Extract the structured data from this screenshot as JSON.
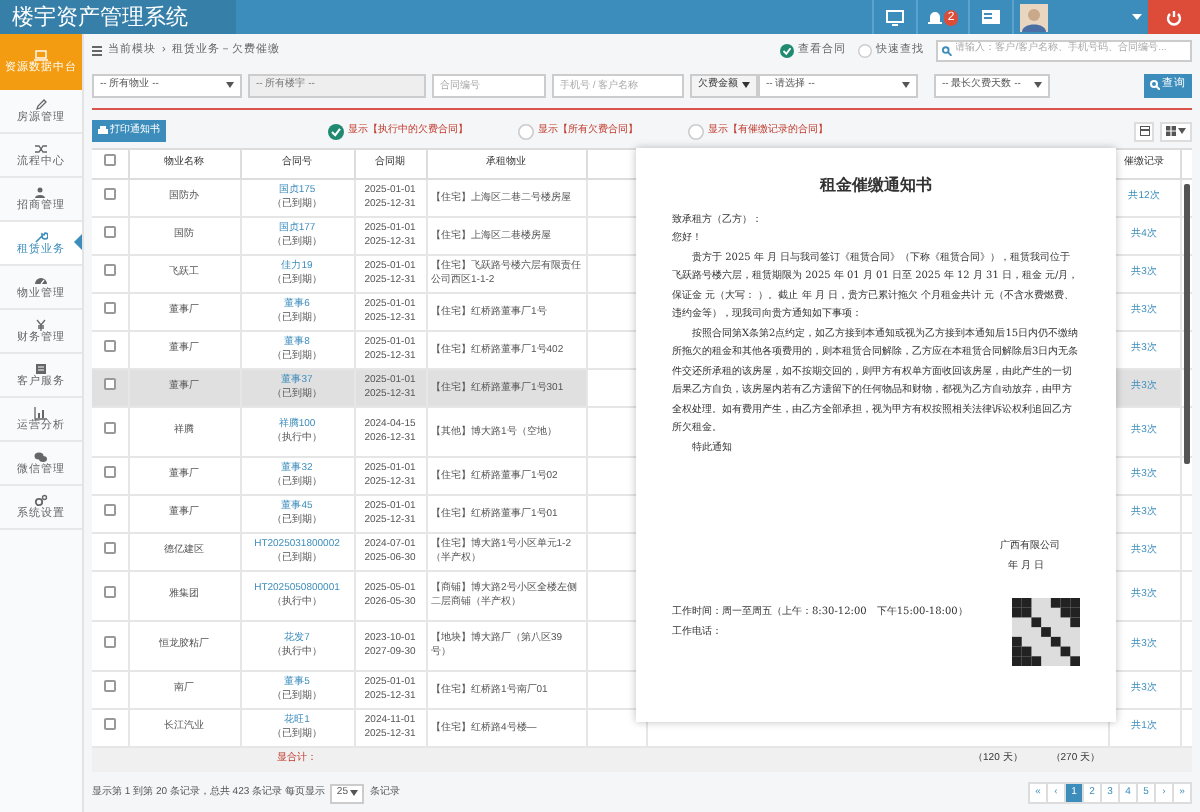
{
  "app": {
    "title": "楼宇资产管理系统",
    "notifications": "2"
  },
  "sidebar": {
    "items": [
      {
        "label": "资源数据中台",
        "selected": false,
        "kind": "home"
      },
      {
        "label": "房源管理",
        "selected": false,
        "kind": "item"
      },
      {
        "label": "流程中心",
        "selected": false,
        "kind": "item"
      },
      {
        "label": "招商管理",
        "selected": false,
        "kind": "item"
      },
      {
        "label": "租赁业务",
        "selected": true,
        "kind": "item"
      },
      {
        "label": "物业管理",
        "selected": false,
        "kind": "item"
      },
      {
        "label": "财务管理",
        "selected": false,
        "kind": "item"
      },
      {
        "label": "客户服务",
        "selected": false,
        "kind": "item"
      },
      {
        "label": "运营分析",
        "selected": false,
        "kind": "item"
      },
      {
        "label": "微信管理",
        "selected": false,
        "kind": "item"
      },
      {
        "label": "系统设置",
        "selected": false,
        "kind": "item"
      }
    ]
  },
  "breadcrumb": {
    "items": [
      "当前模块",
      "租赁业务－欠费催缴"
    ],
    "separator": "›"
  },
  "view_options": [
    {
      "label": "查看合同",
      "selected": true
    },
    {
      "label": "快速查找",
      "selected": false
    }
  ],
  "quick_search": {
    "placeholder": "请输入：客户/客户名称、手机号码、合同编号..."
  },
  "filters": {
    "property": "-- 所有物业 --",
    "building": "-- 所有楼宇 --",
    "contract_no": {
      "placeholder": "合同编号"
    },
    "customer": {
      "placeholder": "手机号 / 客户名称"
    },
    "amount_button": "欠费金额",
    "amount": "-- 请选择 --",
    "days": "-- 最长欠费天数 --",
    "search_button": "查询"
  },
  "print_button": "打印通知书",
  "show_options": [
    {
      "label": "显示【执行中的欠费合同】",
      "selected": true
    },
    {
      "label": "显示【所有欠费合同】",
      "selected": false
    },
    {
      "label": "显示【有催缴记录的合同】",
      "selected": false
    }
  ],
  "table": {
    "select_all": false,
    "columns": [
      "物业名称",
      "合同号",
      "合同期",
      "承租物业",
      "催缴记录"
    ],
    "rows": [
      {
        "name": "国防办",
        "checked": false,
        "contract": "国贞175",
        "status": "（已到期）",
        "start": "2025-01-01",
        "end": "2025-12-31",
        "property": "【住宅】上海区二巷二号楼房屋",
        "record": "共12次",
        "highlighted": false,
        "tall": false
      },
      {
        "name": "国防",
        "checked": false,
        "contract": "国贞177",
        "status": "（已到期）",
        "start": "2025-01-01",
        "end": "2025-12-31",
        "property": "【住宅】上海区二巷楼房屋",
        "record": "共4次",
        "highlighted": false,
        "tall": false
      },
      {
        "name": "飞跃工",
        "checked": false,
        "contract": "佳力19",
        "status": "（已到期）",
        "start": "2025-01-01",
        "end": "2025-12-31",
        "property": "【住宅】飞跃路号楼六层有限责任公司西区1-1-2",
        "record": "共3次",
        "highlighted": false,
        "tall": false
      },
      {
        "name": "董事厂",
        "checked": false,
        "contract": "董事6",
        "status": "（已到期）",
        "start": "2025-01-01",
        "end": "2025-12-31",
        "property": "【住宅】红桥路董事厂1号",
        "record": "共3次",
        "highlighted": false,
        "tall": false
      },
      {
        "name": "董事厂",
        "checked": false,
        "contract": "董事8",
        "status": "（已到期）",
        "start": "2025-01-01",
        "end": "2025-12-31",
        "property": "【住宅】红桥路董事厂1号402",
        "record": "共3次",
        "highlighted": false,
        "tall": false
      },
      {
        "name": "董事厂",
        "checked": false,
        "contract": "董事37",
        "status": "（已到期）",
        "start": "2025-01-01",
        "end": "2025-12-31",
        "property": "【住宅】红桥路董事厂1号301",
        "record": "共3次",
        "highlighted": true,
        "tall": false
      },
      {
        "name": "祥腾",
        "checked": false,
        "contract": "祥腾100",
        "status": "（执行中）",
        "start": "2024-04-15",
        "end": "2026-12-31",
        "property": "【其他】博大路1号（空地）",
        "record": "共3次",
        "highlighted": false,
        "tall": true
      },
      {
        "name": "董事厂",
        "checked": false,
        "contract": "董事32",
        "status": "（已到期）",
        "start": "2025-01-01",
        "end": "2025-12-31",
        "property": "【住宅】红桥路董事厂1号02",
        "record": "共3次",
        "highlighted": false,
        "tall": false
      },
      {
        "name": "董事厂",
        "checked": false,
        "contract": "董事45",
        "status": "（已到期）",
        "start": "2025-01-01",
        "end": "2025-12-31",
        "property": "【住宅】红桥路董事厂1号01",
        "record": "共3次",
        "highlighted": false,
        "tall": false
      },
      {
        "name": "德亿建区",
        "checked": false,
        "contract": "HT2025031800002",
        "status": "（已到期）",
        "start": "2024-07-01",
        "end": "2025-06-30",
        "property": "【住宅】博大路1号小区单元1-2（半产权）",
        "record": "共3次",
        "highlighted": false,
        "tall": false
      },
      {
        "name": "雅集团",
        "checked": false,
        "contract": "HT2025050800001",
        "status": "（执行中）",
        "start": "2025-05-01",
        "end": "2026-05-30",
        "property": "【商铺】博大路2号小区全楼左侧二层商铺（半产权）",
        "record": "共3次",
        "highlighted": false,
        "tall": true
      },
      {
        "name": "恒龙胶粘厂",
        "checked": false,
        "contract": "花发7",
        "status": "（执行中）",
        "start": "2023-10-01",
        "end": "2027-09-30",
        "property": "【地块】博大路厂（第八区39号）",
        "record": "共3次",
        "highlighted": false,
        "tall": true
      },
      {
        "name": "南厂",
        "checked": false,
        "contract": "董事5",
        "status": "（已到期）",
        "start": "2025-01-01",
        "end": "2025-12-31",
        "property": "【住宅】红桥路1号南厂01",
        "record": "共3次",
        "highlighted": false,
        "tall": false
      },
      {
        "name": "长江汽业",
        "checked": false,
        "contract": "花旺1",
        "status": "（已到期）",
        "start": "2024-11-01",
        "end": "2025-12-31",
        "property": "【住宅】红桥路4号楼—",
        "record": "共1次",
        "highlighted": false,
        "tall": false
      }
    ],
    "total_label": "显合计：",
    "total_days": [
      "（120 天）",
      "（270 天）"
    ]
  },
  "notice": {
    "title": "租金催缴通知书",
    "greeting": "致承租方（乙方）：",
    "salutation": "您好！",
    "paragraphs": [
      "贵方于 2025 年 月 日与我司签订《租赁合同》（下称《租赁合同》），租赁我司位于飞跃路号楼六层，租赁期限为 2025 年 01 月 01 日至 2025 年 12 月 31 日，租金 元/月，保证金 元（大写： ）。截止 年 月 日，贵方已累计拖欠 个月租金共计 元（不含水费燃费、违约金等），现我司向贵方通知如下事项：",
      "按照合同第X条第2点约定，如乙方接到本通知或视为乙方接到本通知后15日内仍不缴纳所拖欠的租金和其他各项费用的，则本租赁合同解除，乙方应在本租赁合同解除后3日内无条件交还所承租的该房屋，如不按期交回的，则甲方有权单方面收回该房屋，由此产生的一切后果乙方自负，该房屋内若有乙方遗留下的任何物品和财物，都视为乙方自动放弃，由甲方全权处理。如有费用产生，由乙方全部承担，视为甲方有权按照相关法律诉讼权利追回乙方所欠租金。"
    ],
    "closing": "特此通知",
    "company": "广西有限公司",
    "date": "年 月 日",
    "hours": "工作时间：周一至周五（上午：8:30-12:00　下午15:00-18:00）",
    "phone": "工作电话："
  },
  "footer": {
    "summary": "显示第 1 到第 20 条记录，总共 423 条记录 每页显示",
    "page_size": "25",
    "suffix": "条记录"
  },
  "pagination": [
    {
      "label": "«",
      "selected": false
    },
    {
      "label": "‹",
      "selected": false
    },
    {
      "label": "1",
      "selected": true
    },
    {
      "label": "2",
      "selected": false
    },
    {
      "label": "3",
      "selected": false
    },
    {
      "label": "4",
      "selected": false
    },
    {
      "label": "5",
      "selected": false
    },
    {
      "label": "›",
      "selected": false
    },
    {
      "label": "»",
      "selected": false
    }
  ]
}
